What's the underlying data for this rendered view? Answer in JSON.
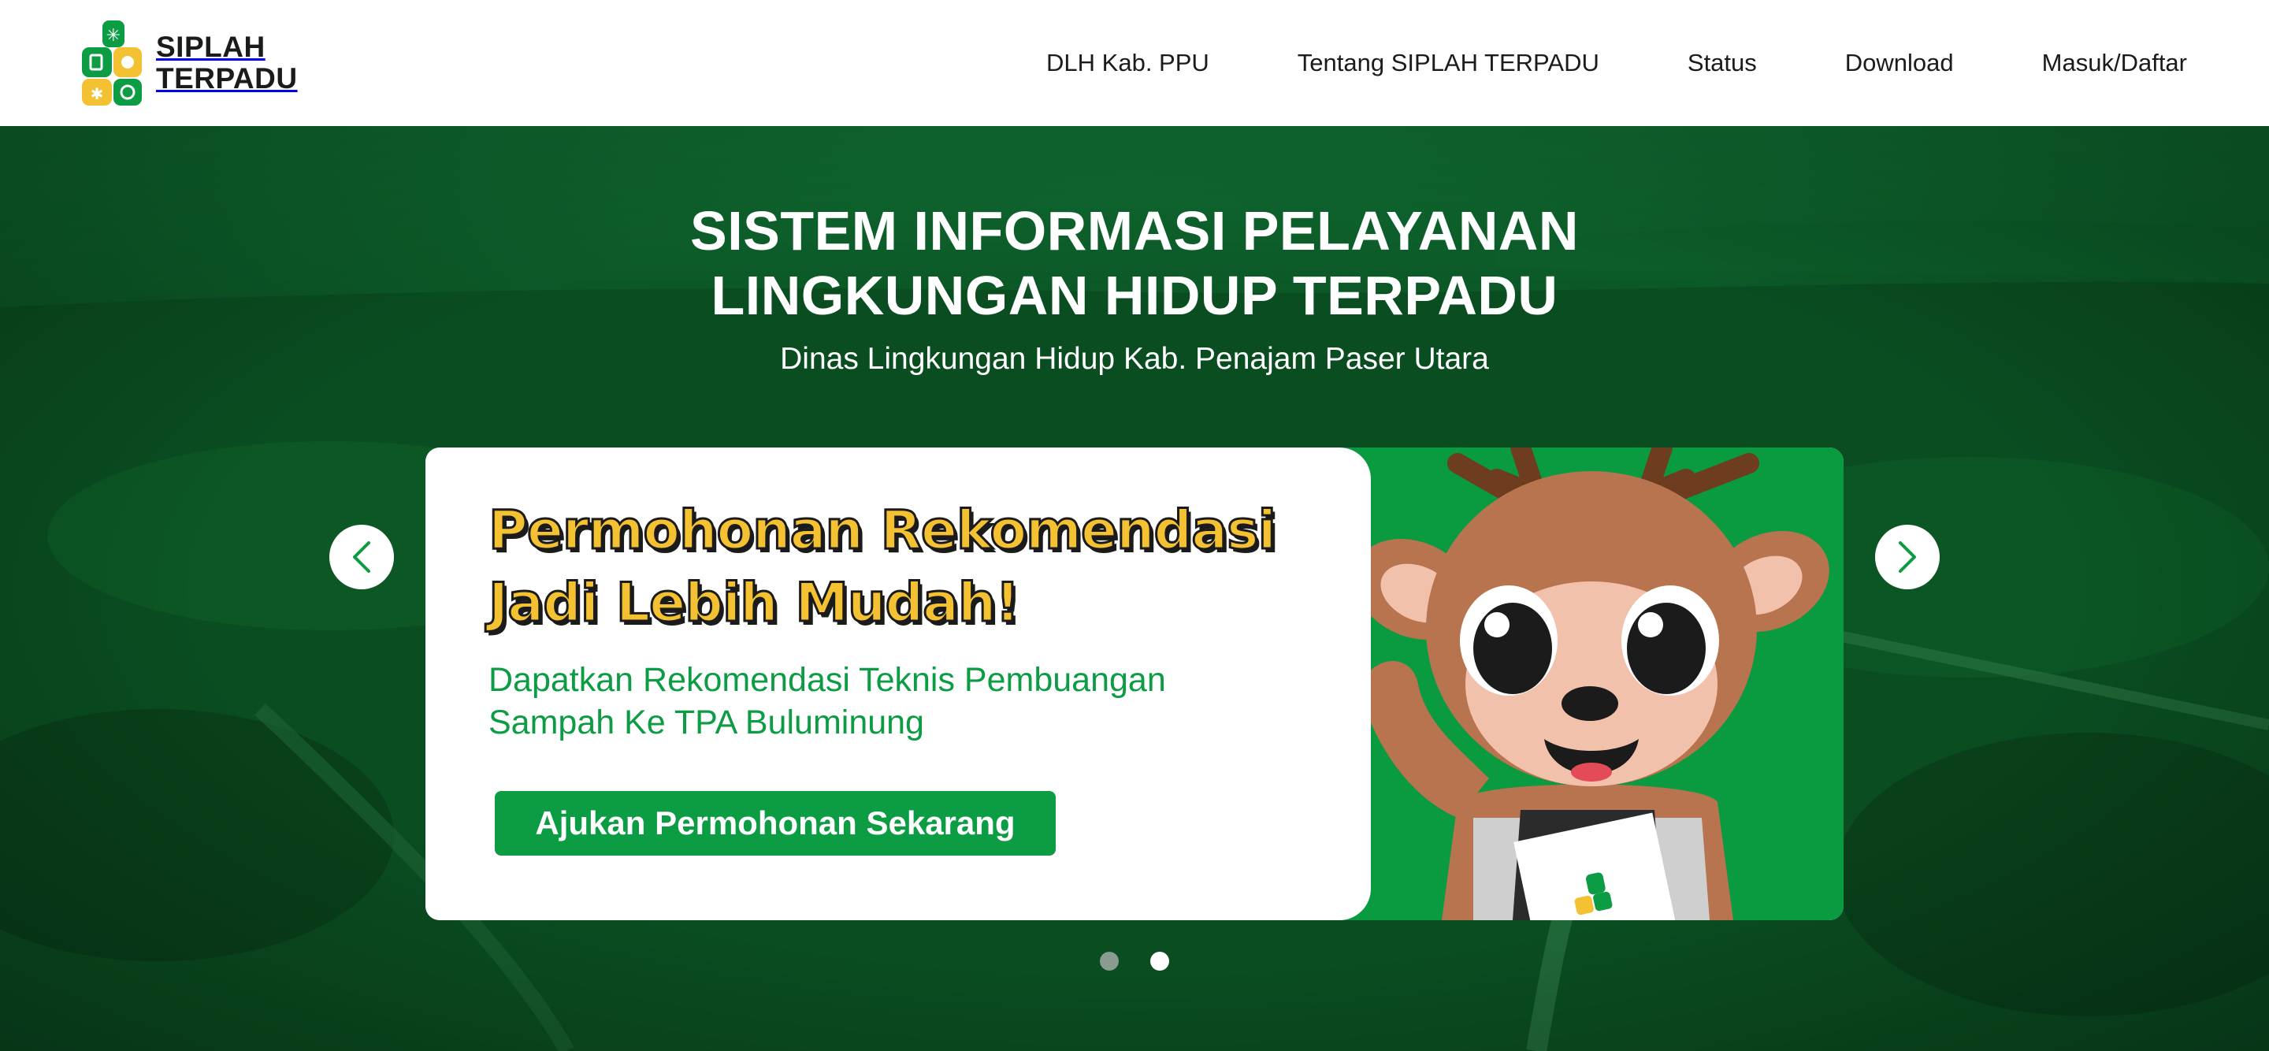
{
  "header": {
    "logo": {
      "line1": "SIPLAH",
      "line2": "TERPADU"
    },
    "nav": [
      {
        "label": "DLH Kab. PPU"
      },
      {
        "label": "Tentang SIPLAH TERPADU"
      },
      {
        "label": "Status"
      },
      {
        "label": "Download"
      },
      {
        "label": "Masuk/Daftar"
      }
    ]
  },
  "hero": {
    "title_line1": "SISTEM INFORMASI PELAYANAN",
    "title_line2": "LINGKUNGAN HIDUP TERPADU",
    "subtitle": "Dinas Lingkungan Hidup Kab. Penajam Paser Utara"
  },
  "slide": {
    "headline_line1": "Permohonan Rekomendasi",
    "headline_line2": "Jadi Lebih Mudah!",
    "desc_line1": "Dapatkan Rekomendasi Teknis Pembuangan",
    "desc_line2": "Sampah Ke TPA Buluminung",
    "cta_label": "Ajukan Permohonan Sekarang"
  },
  "carousel": {
    "slide_count": 2,
    "active_index": 1
  },
  "colors": {
    "brand_green": "#0c9c44",
    "hero_green": "#0b4f22",
    "headline_yellow": "#f4c132",
    "logo_yellow": "#f4c132"
  },
  "icons": {
    "prev": "chevron-left-icon",
    "next": "chevron-right-icon"
  }
}
